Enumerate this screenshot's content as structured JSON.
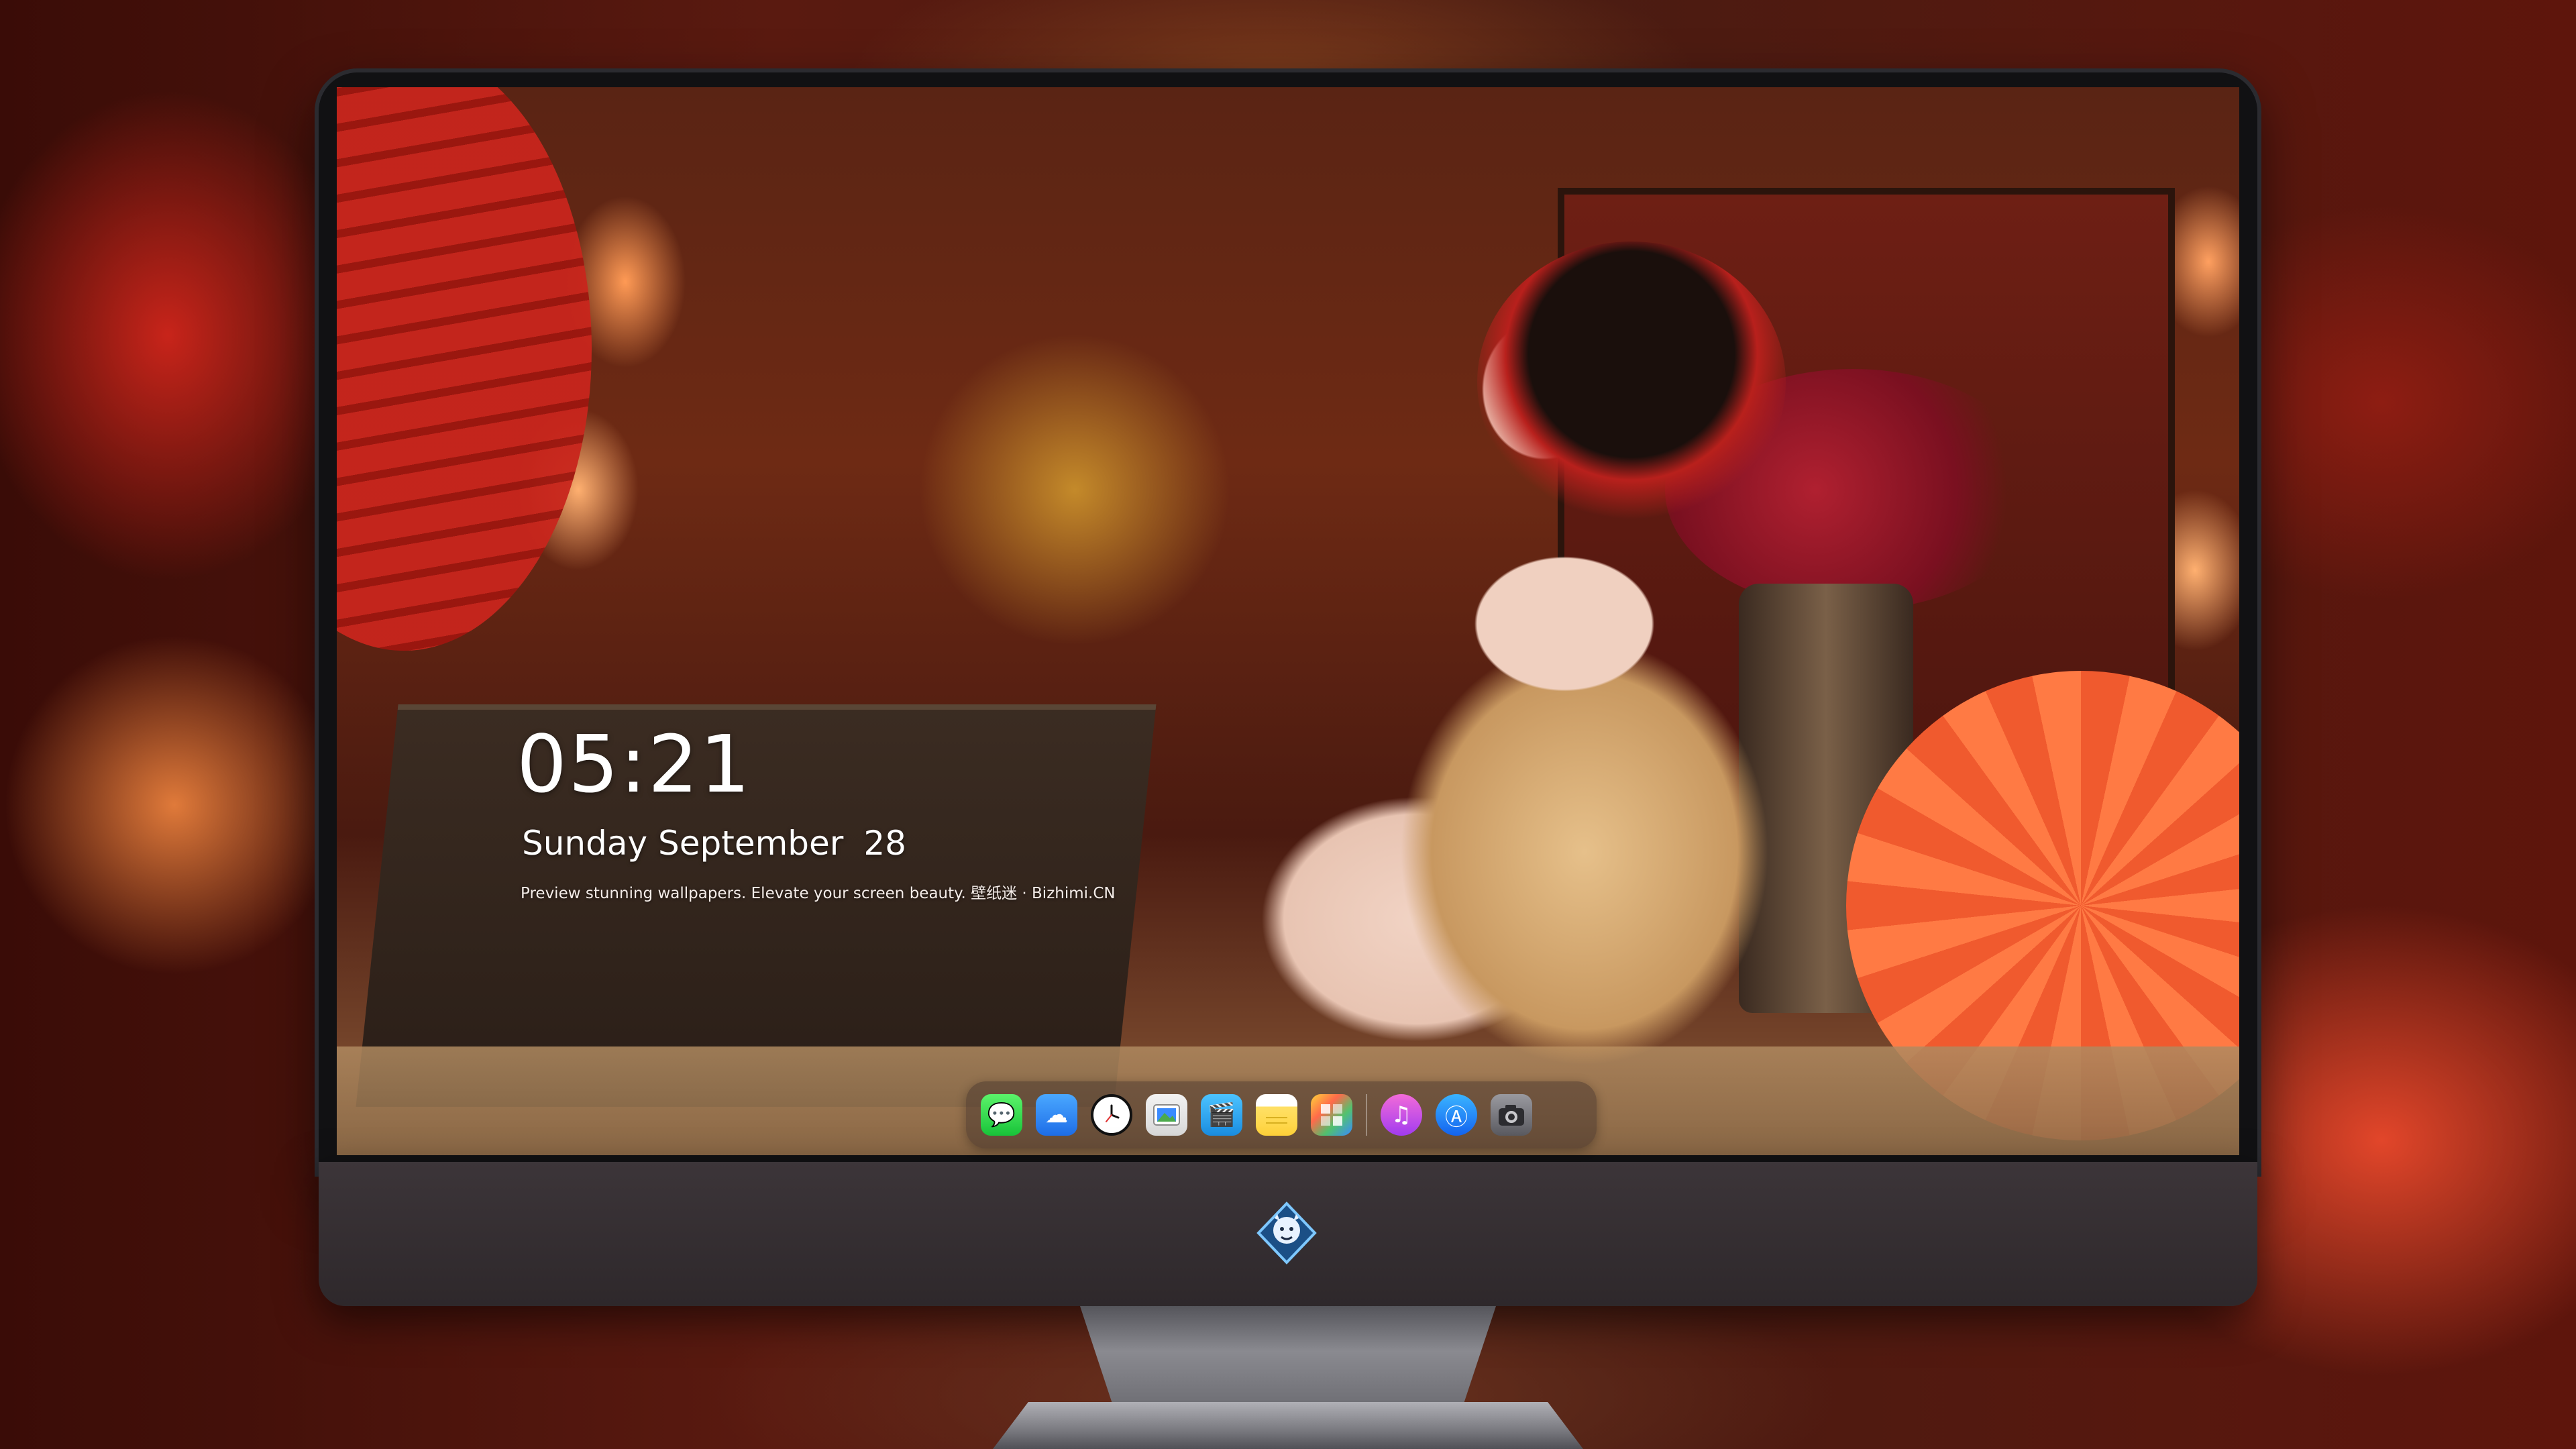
{
  "lock_screen": {
    "time": "05:21",
    "weekday": "Sunday",
    "month": "September",
    "day": "28",
    "tagline": "Preview stunning wallpapers. Elevate your screen beauty. 壁纸迷 · Bizhimi.CN"
  },
  "dock": {
    "apps": [
      {
        "name": "messages-icon",
        "glyph": "💬"
      },
      {
        "name": "weather-icon",
        "glyph": "☁"
      },
      {
        "name": "clock-icon",
        "glyph": ""
      },
      {
        "name": "preview-icon",
        "glyph": ""
      },
      {
        "name": "clips-icon",
        "glyph": "🎬"
      },
      {
        "name": "notes-icon",
        "glyph": ""
      },
      {
        "name": "photos-icon",
        "glyph": ""
      },
      {
        "name": "itunes-icon",
        "glyph": "♫"
      },
      {
        "name": "app-store-icon",
        "glyph": "Ⓐ"
      },
      {
        "name": "camera-icon",
        "glyph": "📷"
      }
    ]
  },
  "monitor": {
    "logo_icon": "dragon-badge-icon"
  },
  "colors": {
    "accent_red": "#c8251c",
    "dock_bg": "rgba(60,45,40,0.45)",
    "chin": "#3c3539"
  }
}
